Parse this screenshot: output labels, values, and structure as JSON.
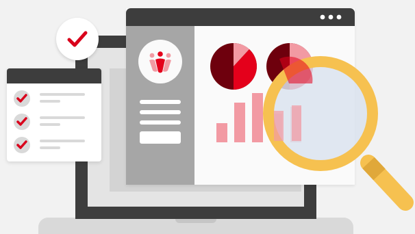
{
  "colors": {
    "background": "#f2f2f2",
    "laptop_dark": "#3d3d3d",
    "laptop_base": "#d9d9d9",
    "screen_inner": "#e4e4e4",
    "window_titlebar": "#3d3d3d",
    "window_sidebar": "#a6a6a6",
    "window_content": "#fafafa",
    "accent_red": "#e4001b",
    "dark_red": "#6e000d",
    "pink": "#f29aa3",
    "check_red": "#d9001b",
    "magnifier_frame": "#f6c150",
    "magnifier_glass": "#dbe3ef"
  },
  "icons": {
    "window_menu": "three-dots-icon",
    "logo": "people-logo-icon",
    "badge": "checkmark-icon",
    "checklist_item": "checkmark-icon",
    "magnifier": "magnifying-glass-icon"
  },
  "checklist": {
    "items": [
      {
        "checked": true
      },
      {
        "checked": true
      },
      {
        "checked": true
      }
    ]
  }
}
